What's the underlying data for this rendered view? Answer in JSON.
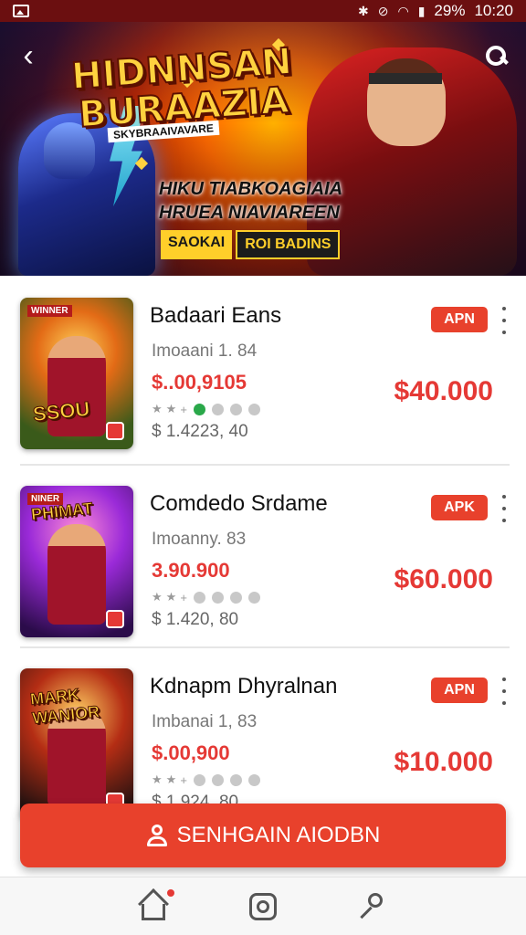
{
  "status_bar": {
    "battery": "29%",
    "time": "10:20",
    "icons": [
      "image-icon",
      "bluetooth-icon",
      "mute-icon",
      "wifi-icon",
      "signal-icon"
    ]
  },
  "banner": {
    "title_line1": "HIDNNSAN",
    "title_line2": "BURAAZIA",
    "subtitle": "SKYBRAAIVAVARE",
    "desc_line1": "HIKU TIABKOAGIAIA",
    "desc_line2": "HRUEA NIAVIAREEN",
    "chip1": "SAOKAI",
    "chip2": "ROI BADINS",
    "icons": [
      "back-arrow-icon",
      "search-icon"
    ]
  },
  "items": [
    {
      "name": "Badaari Eans",
      "sub": "Imoaani 1. 84",
      "price_red": "$..00,9105",
      "rating_dots_filled": 1,
      "price_grey": "$ 1.4223, 40",
      "badge": "APN",
      "price_big": "$40.000",
      "thumb_tag": "WINNER",
      "thumb_title": "SSOU",
      "thumb_color": "#e36b16"
    },
    {
      "name": "Comdedo Srdame",
      "sub": "Imoanny. 83",
      "price_red": "3.90.900",
      "rating_dots_filled": 0,
      "price_grey": "$ 1.420, 80",
      "badge": "APK",
      "price_big": "$60.000",
      "thumb_tag": "NINER",
      "thumb_title": "PHIMAT",
      "thumb_color": "#9a2ad8"
    },
    {
      "name": "Kdnapm Dhyralnan",
      "sub": "Imbanai 1, 83",
      "price_red": "$.00,900",
      "rating_dots_filled": 0,
      "price_grey": "$.1.924, 80",
      "badge": "APN",
      "price_big": "$10.000",
      "thumb_tag": "",
      "thumb_title": "MARK WANIOR",
      "thumb_color": "#b42d14"
    }
  ],
  "cta": {
    "label": "SENHGAIN AIODBN",
    "icon": "user-icon"
  },
  "bottom_nav": {
    "items": [
      "home-icon",
      "instagram-icon",
      "key-icon"
    ]
  },
  "colors": {
    "accent": "#e8412c",
    "price_red": "#e53935",
    "status_bar": "#6b0f10",
    "rating_on": "#2aa84a"
  }
}
